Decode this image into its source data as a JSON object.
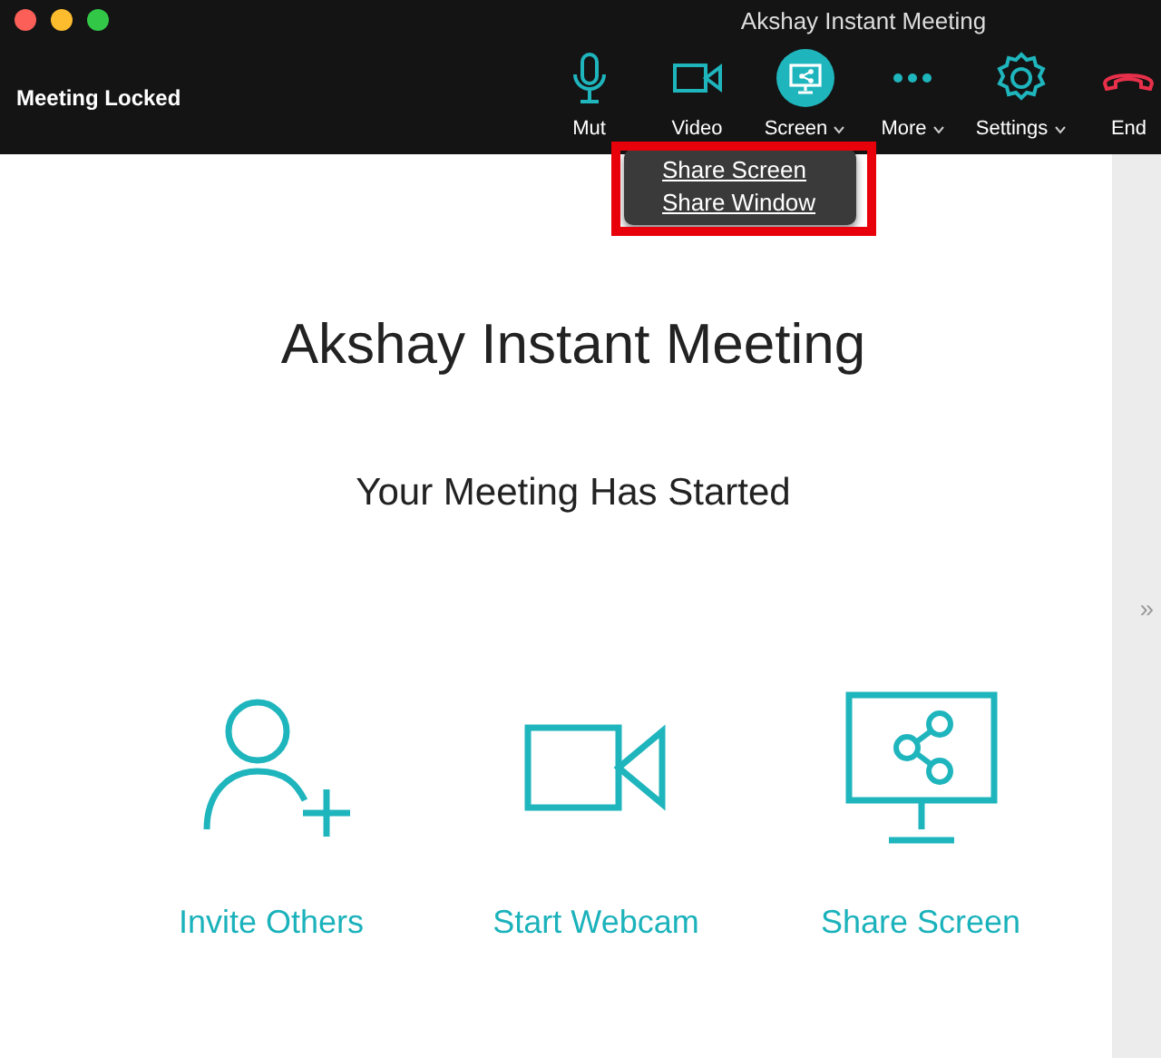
{
  "window": {
    "title": "Akshay Instant Meeting"
  },
  "status": "Meeting Locked",
  "toolbar": [
    {
      "kind": "mic",
      "label": "Mut",
      "dropdown": false,
      "selected": false
    },
    {
      "kind": "video",
      "label": "Video",
      "dropdown": false,
      "selected": false
    },
    {
      "kind": "screen",
      "label": "Screen",
      "dropdown": true,
      "selected": true
    },
    {
      "kind": "more",
      "label": "More",
      "dropdown": true,
      "selected": false
    },
    {
      "kind": "settings",
      "label": "Settings",
      "dropdown": true,
      "selected": false
    },
    {
      "kind": "end",
      "label": "End",
      "dropdown": false,
      "selected": false
    }
  ],
  "menu": {
    "highlighted": true,
    "items": [
      "Share Screen",
      "Share Window"
    ]
  },
  "meeting_title": "Akshay Instant Meeting",
  "subtitle": "Your Meeting Has Started",
  "actions": [
    {
      "kind": "invite",
      "label": "Invite Others"
    },
    {
      "kind": "webcam",
      "label": "Start Webcam"
    },
    {
      "kind": "share",
      "label": "Share Screen"
    }
  ],
  "side_toggle": "»"
}
